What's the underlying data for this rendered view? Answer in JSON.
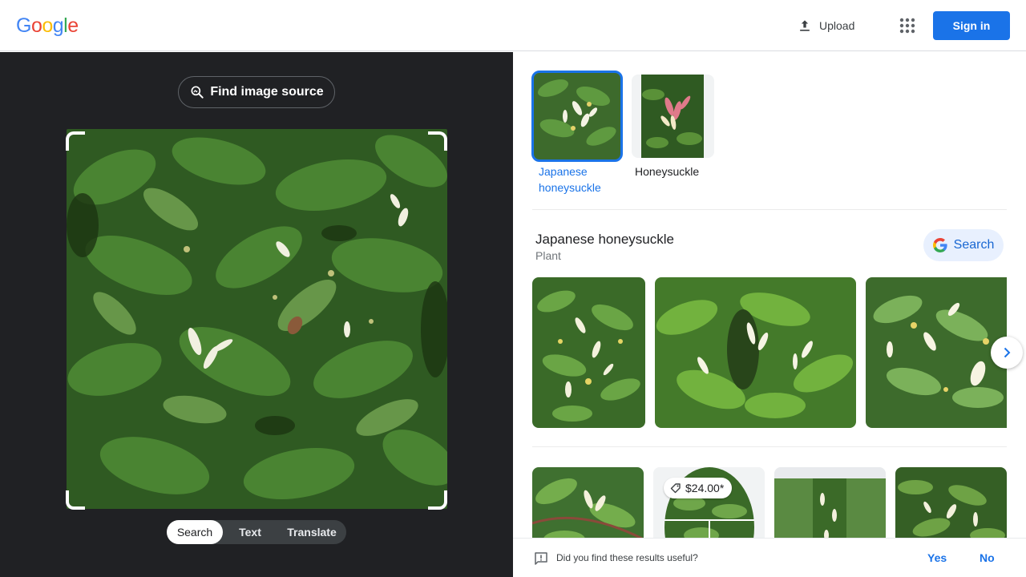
{
  "header": {
    "logo": [
      "G",
      "o",
      "o",
      "g",
      "l",
      "e"
    ],
    "logo_colors": [
      "#4285f4",
      "#ea4335",
      "#fbbc05",
      "#4285f4",
      "#34a853",
      "#ea4335"
    ],
    "upload_label": "Upload",
    "apps_icon": "apps-grid-icon",
    "signin_label": "Sign in"
  },
  "left": {
    "find_source_label": "Find image source",
    "modes": [
      "Search",
      "Text",
      "Translate"
    ],
    "active_mode": "Search"
  },
  "results": {
    "chips": [
      {
        "label": "Japanese honeysuckle",
        "selected": true
      },
      {
        "label": "Honeysuckle",
        "selected": false
      }
    ],
    "entity": {
      "title": "Japanese honeysuckle",
      "subtitle": "Plant",
      "search_label": "Search"
    },
    "price_tag": "$24.00*"
  },
  "feedback": {
    "question": "Did you find these results useful?",
    "yes_label": "Yes",
    "no_label": "No"
  },
  "colors": {
    "accent": "#1a73e8",
    "dark_panel": "#202124",
    "leaf_green": "#3a6b2a"
  }
}
